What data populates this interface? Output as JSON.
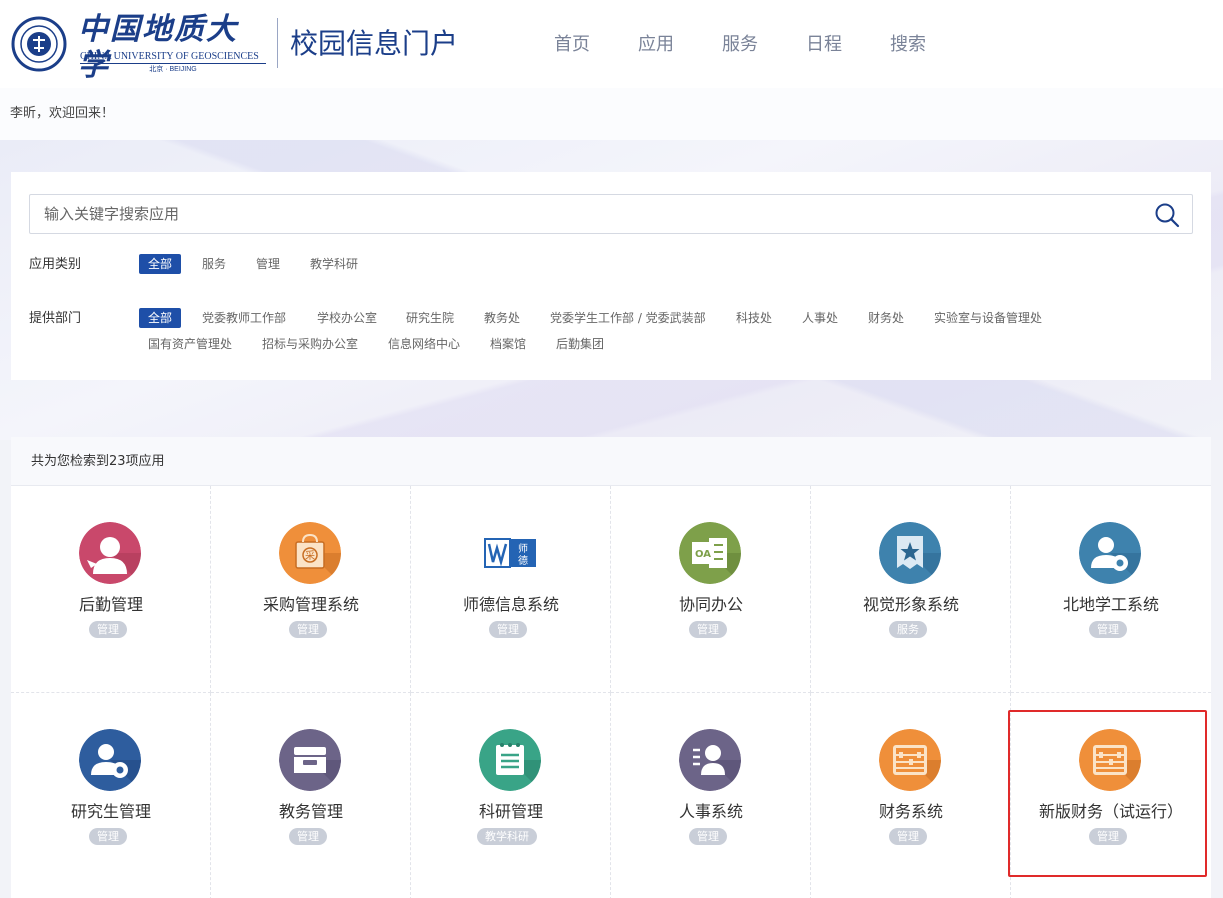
{
  "header": {
    "logo_cn": "中国地质大学",
    "logo_en": "CHINA UNIVERSITY OF GEOSCIENCES",
    "logo_city": "北京 · BEIJING",
    "portal_title": "校园信息门户",
    "nav": [
      {
        "label": "首页"
      },
      {
        "label": "应用"
      },
      {
        "label": "服务"
      },
      {
        "label": "日程"
      },
      {
        "label": "搜索"
      }
    ]
  },
  "welcome": {
    "text": "李昕，欢迎回来！"
  },
  "search": {
    "placeholder": "输入关键字搜索应用",
    "value": ""
  },
  "filters": {
    "category_label": "应用类别",
    "categories": [
      {
        "label": "全部",
        "active": true
      },
      {
        "label": "服务"
      },
      {
        "label": "管理"
      },
      {
        "label": "教学科研"
      }
    ],
    "department_label": "提供部门",
    "departments": [
      {
        "label": "全部",
        "active": true
      },
      {
        "label": "党委教师工作部"
      },
      {
        "label": "学校办公室"
      },
      {
        "label": "研究生院"
      },
      {
        "label": "教务处"
      },
      {
        "label": "党委学生工作部 / 党委武装部"
      },
      {
        "label": "科技处"
      },
      {
        "label": "人事处"
      },
      {
        "label": "财务处"
      },
      {
        "label": "实验室与设备管理处"
      },
      {
        "label": "国有资产管理处"
      },
      {
        "label": "招标与采购办公室"
      },
      {
        "label": "信息网络中心"
      },
      {
        "label": "档案馆"
      },
      {
        "label": "后勤集团"
      }
    ]
  },
  "results": {
    "summary": "共为您检索到23项应用",
    "apps": [
      {
        "name": "后勤管理",
        "tag": "管理",
        "icon": "logistics-person-icon",
        "color": "#c9486b"
      },
      {
        "name": "采购管理系统",
        "tag": "管理",
        "icon": "procurement-bag-icon",
        "color": "#ef8f3a"
      },
      {
        "name": "师德信息系统",
        "tag": "管理",
        "icon": "shide-logo-icon",
        "color": "#2464b4"
      },
      {
        "name": "协同办公",
        "tag": "管理",
        "icon": "oa-document-icon",
        "color": "#7ea04a"
      },
      {
        "name": "视觉形象系统",
        "tag": "服务",
        "icon": "star-badge-icon",
        "color": "#3e82ad"
      },
      {
        "name": "北地学工系统",
        "tag": "管理",
        "icon": "user-gear-icon",
        "color": "#3e82ad"
      },
      {
        "name": "研究生管理",
        "tag": "管理",
        "icon": "user-gear-icon",
        "color": "#2e5d9e"
      },
      {
        "name": "教务管理",
        "tag": "管理",
        "icon": "inbox-tray-icon",
        "color": "#6c6488"
      },
      {
        "name": "科研管理",
        "tag": "教学科研",
        "icon": "notepad-icon",
        "color": "#39a487"
      },
      {
        "name": "人事系统",
        "tag": "管理",
        "icon": "person-list-icon",
        "color": "#6c6488"
      },
      {
        "name": "财务系统",
        "tag": "管理",
        "icon": "abacus-icon",
        "color": "#ef8f3a"
      },
      {
        "name": "新版财务（试运行）",
        "tag": "管理",
        "icon": "abacus-icon",
        "color": "#ef8f3a"
      }
    ]
  },
  "colors": {
    "brand": "#1b3e89",
    "active_chip": "#1e4fa8",
    "highlight": "#e02a2a"
  }
}
